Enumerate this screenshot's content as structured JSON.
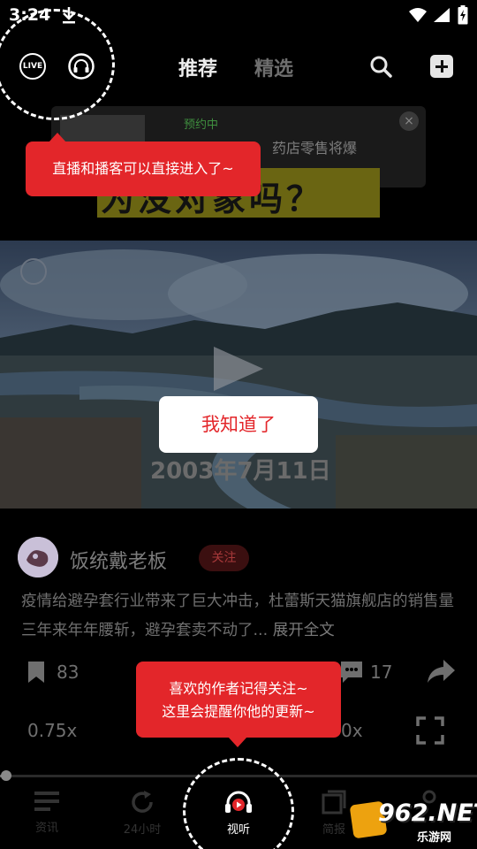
{
  "status_bar": {
    "time": "3:24"
  },
  "top_bar": {
    "live_label": "LIVE",
    "tabs": [
      {
        "label": "推荐",
        "active": true
      },
      {
        "label": "精选",
        "active": false
      }
    ]
  },
  "background_ad": {
    "tag": "预约中",
    "text": "药店零售将爆",
    "headline": "为没对象吗？",
    "close": "×"
  },
  "tooltip_live": "直播和播客可以直接进入了~",
  "tooltip_follow": [
    "喜欢的作者记得关注~",
    "这里会提醒你他的更新~"
  ],
  "video": {
    "got_it": "我知道了",
    "date_overlay": "2003年7月11日"
  },
  "post": {
    "author": "饭统戴老板",
    "follow_label": "关注",
    "description": "疫情给避孕套行业带来了巨大冲击，杜蕾斯天猫旗舰店的销售量三年来年年腰斩，避孕套卖不动了...",
    "expand_label": "展开全文",
    "bookmarks": "83",
    "comments": "17",
    "speed": "0.75x",
    "speed_right": "0x"
  },
  "progress": {
    "value_fraction": 0.01
  },
  "bottom_nav": [
    {
      "label": "资讯",
      "icon": "news-icon",
      "active": false
    },
    {
      "label": "24小时",
      "icon": "refresh-icon",
      "active": false
    },
    {
      "label": "视听",
      "icon": "headphones-play-icon",
      "active": true
    },
    {
      "label": "简报",
      "icon": "brief-icon",
      "active": false
    }
  ],
  "watermark": {
    "number": "962.NET",
    "sub": "乐游网"
  },
  "colors": {
    "accent": "#e3262a",
    "background": "#000000"
  }
}
